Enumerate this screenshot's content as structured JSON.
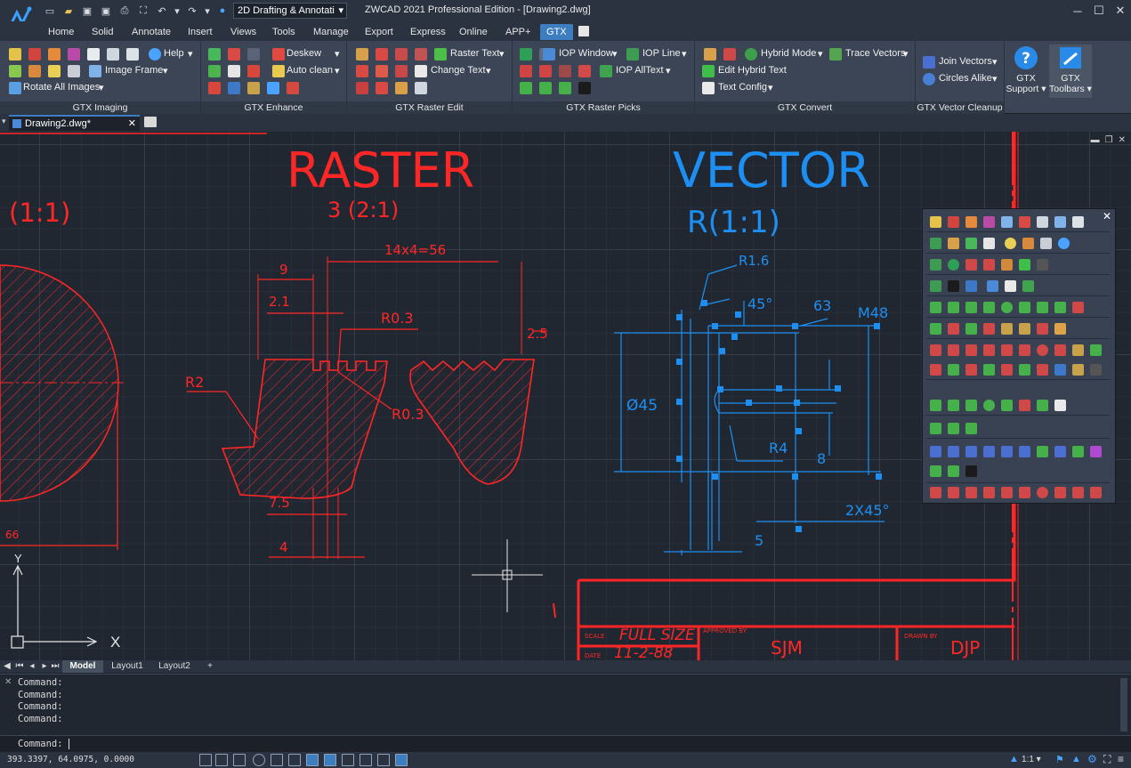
{
  "app": {
    "title": "ZWCAD 2021 Professional Edition - [Drawing2.dwg]",
    "workspace": "2D Drafting & Annotati",
    "window_controls": [
      "─",
      "☐",
      "✕"
    ]
  },
  "menu_tabs": [
    "Home",
    "Solid",
    "Annotate",
    "Insert",
    "Views",
    "Tools",
    "Manage",
    "Export",
    "Express",
    "Online",
    "APP+",
    "GTX"
  ],
  "active_tab": "GTX",
  "ribbon": {
    "imaging": {
      "title": "GTX Imaging",
      "help": "Help",
      "image_frame": "Image Frame",
      "rotate_all": "Rotate All Images"
    },
    "enhance": {
      "title": "GTX Enhance",
      "deskew": "Deskew",
      "auto_clean": "Auto clean"
    },
    "raster_edit": {
      "title": "GTX Raster Edit",
      "raster_text": "Raster Text",
      "change_text": "Change Text"
    },
    "raster_picks": {
      "title": "GTX Raster Picks",
      "iop_window": "IOP Window",
      "iop_line": "IOP Line",
      "iop_alltext": "IOP AllText"
    },
    "convert": {
      "title": "GTX Convert",
      "hybrid_mode": "Hybrid Mode",
      "trace_vectors": "Trace Vectors",
      "edit_hybrid_text": "Edit Hybrid Text",
      "text_config": "Text Config"
    },
    "vector_cleanup": {
      "title": "GTX Vector Cleanup",
      "join_vectors": "Join Vectors",
      "circles_alike": "Circles Alike"
    },
    "support": {
      "line1": "GTX",
      "line2": "Support"
    },
    "toolbars": {
      "line1": "GTX",
      "line2": "Toolbars"
    }
  },
  "document_tab": "Drawing2.dwg*",
  "drawing": {
    "raster_title": "RASTER",
    "vector_title": "VECTOR",
    "raster_scale": "(1:1)",
    "raster_sub": "3 (2:1)",
    "vector_sub": "R(1:1)",
    "raster_dims": {
      "d1": "14x4=56",
      "d2": "9",
      "d3": "2.1",
      "d4": "R0.3",
      "d5": "2.5",
      "d6": "R2",
      "d7": "R0.3",
      "d8": "7.5",
      "d9": "4",
      "d10": "66"
    },
    "vector_dims": {
      "d1": "R1.6",
      "d2": "45°",
      "d3": "63",
      "d4": "M48",
      "d5": "Ø45",
      "d6": "R4",
      "d7": "8",
      "d8": "2X45°",
      "d9": "5"
    },
    "title_block": {
      "scale_label": "SCALE",
      "scale_value": "FULL SIZE",
      "date_label": "DATE",
      "date_value": "11-2-88",
      "approved_label": "APPROVED BY",
      "approved_value": "SJM",
      "drawn_label": "DRAWN BY",
      "drawn_value": "DJP"
    },
    "ucs_x": "X",
    "ucs_y": "Y"
  },
  "layout_tabs": [
    "Model",
    "Layout1",
    "Layout2",
    "+"
  ],
  "command": {
    "lines": [
      "Command:",
      "Command:",
      "Command:",
      "Command:"
    ],
    "prompt": "Command:"
  },
  "status": {
    "coords": "393.3397, 64.0975, 0.0000",
    "scale": "1:1"
  },
  "colors": {
    "raster": "#ff2626",
    "vector": "#1e8ff2",
    "accent": "#3d7ec0"
  }
}
